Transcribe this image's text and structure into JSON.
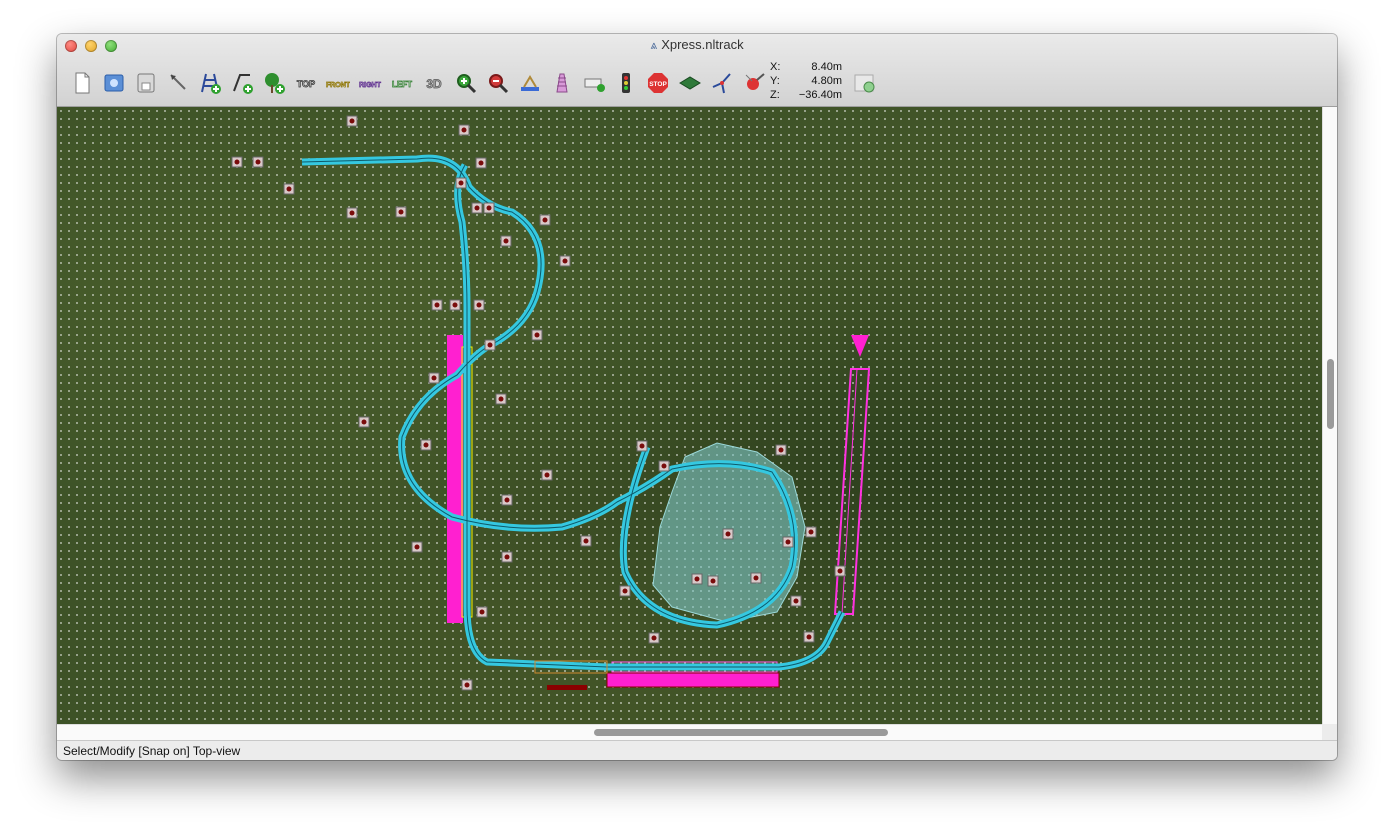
{
  "window": {
    "title": "Xpress.nltrack"
  },
  "toolbar": {
    "buttons": [
      {
        "name": "new-document-icon"
      },
      {
        "name": "open-icon"
      },
      {
        "name": "save-icon"
      },
      {
        "name": "select-icon"
      },
      {
        "name": "add-support-icon"
      },
      {
        "name": "add-track-icon"
      },
      {
        "name": "add-tree-icon"
      },
      {
        "name": "view-top-icon",
        "label": "TOP"
      },
      {
        "name": "view-front-icon",
        "label": "FRONT"
      },
      {
        "name": "view-right-icon",
        "label": "RIGHT"
      },
      {
        "name": "view-left-icon",
        "label": "LEFT"
      },
      {
        "name": "view-3d-icon",
        "label": "3D"
      },
      {
        "name": "zoom-in-icon"
      },
      {
        "name": "zoom-out-icon"
      },
      {
        "name": "station-icon"
      },
      {
        "name": "lift-icon"
      },
      {
        "name": "transport-icon"
      },
      {
        "name": "traffic-light-icon"
      },
      {
        "name": "stop-icon",
        "label": "STOP"
      },
      {
        "name": "terrain-icon"
      },
      {
        "name": "wind-icon"
      },
      {
        "name": "pick-icon"
      }
    ]
  },
  "coords": {
    "x_label": "X:",
    "x_value": "8.40m",
    "y_label": "Y:",
    "y_value": "4.80m",
    "z_label": "Z:",
    "z_value": "−36.40m"
  },
  "status": {
    "text": "Select/Modify [Snap on] Top-view"
  },
  "colors": {
    "track": "#35c8e0",
    "station": "#ff1fd0",
    "lift": "#ff1fd0",
    "support": "#7a0c0c",
    "water": "#7ec8c8",
    "grass": "#3d5227"
  }
}
